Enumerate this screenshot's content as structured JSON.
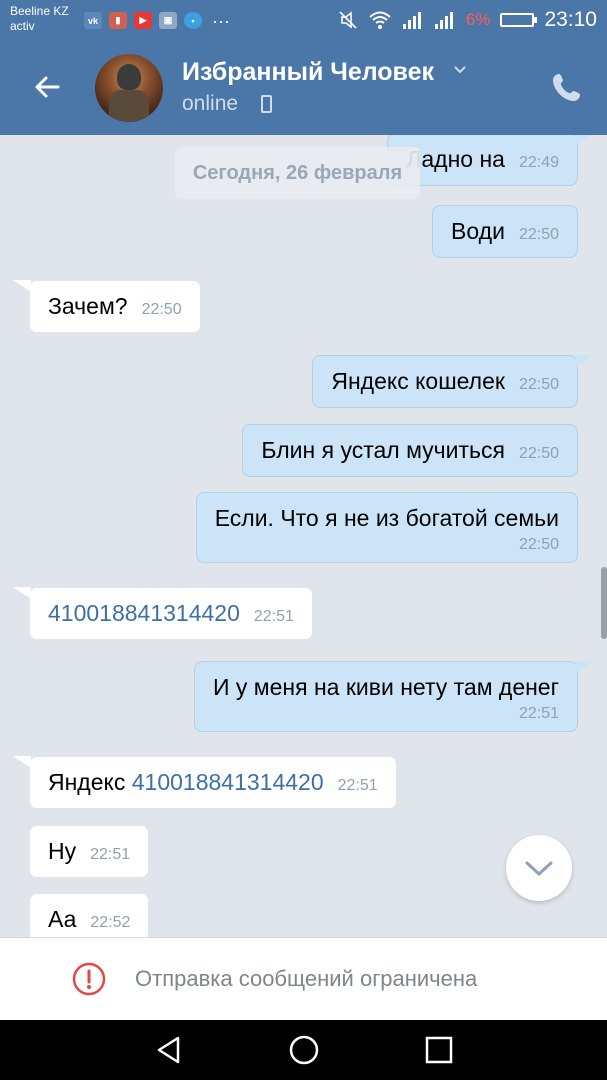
{
  "status_bar": {
    "carrier_line1": "Beeline KZ",
    "carrier_line2": "activ",
    "battery": "6%",
    "time": "23:10",
    "notification_icons": [
      "vk-icon",
      "reminder-icon",
      "youtube-icon",
      "gallery-icon",
      "message-icon"
    ]
  },
  "header": {
    "contact_name": "Избранный Человек",
    "status": "online"
  },
  "chat": {
    "date_separator": "Сегодня, 26 февраля",
    "messages": [
      {
        "dir": "out",
        "text": "Ладно на",
        "time": "22:49"
      },
      {
        "dir": "out",
        "text": "Води",
        "time": "22:50"
      },
      {
        "dir": "in",
        "text": "Зачем?",
        "time": "22:50"
      },
      {
        "dir": "out",
        "text": "Яндекс кошелек",
        "time": "22:50"
      },
      {
        "dir": "out",
        "text": "Блин я устал мучиться",
        "time": "22:50"
      },
      {
        "dir": "out",
        "text": "Если. Что я не из богатой семьи",
        "time": "22:50"
      },
      {
        "dir": "in",
        "text": "410018841314420",
        "time": "22:51"
      },
      {
        "dir": "out",
        "text": "И у меня на киви нету там денег",
        "time": "22:51"
      },
      {
        "dir": "in",
        "prefix": "Яндекс ",
        "text": "410018841314420",
        "time": "22:51"
      },
      {
        "dir": "in",
        "text": "Ну",
        "time": "22:51"
      },
      {
        "dir": "in",
        "text": "Аа",
        "time": "22:52"
      }
    ]
  },
  "footer": {
    "restriction_text": "Отправка сообщений ограничена"
  },
  "colors": {
    "header": "#4a76a8",
    "outgoing_bubble": "#cce4f7",
    "incoming_bubble": "#ffffff",
    "chat_background": "#dfe5eb",
    "link": "#3f70a4",
    "warning": "#e64646"
  }
}
